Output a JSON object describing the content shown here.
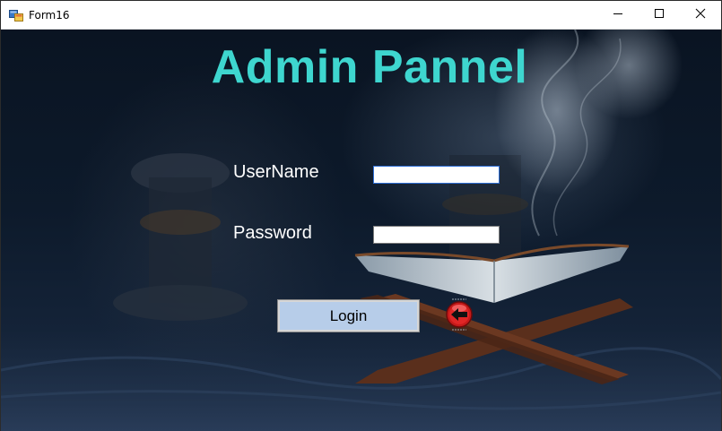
{
  "window": {
    "title": "Form16"
  },
  "page": {
    "heading": "Admin Pannel"
  },
  "form": {
    "username_label": "UserName",
    "username_value": "",
    "password_label": "Password",
    "password_value": "",
    "login_label": "Login"
  },
  "colors": {
    "heading": "#3ed6cf",
    "login_button": "#b7cde9",
    "back_button": "#d21e1e"
  },
  "icons": {
    "app": "form-app-icon",
    "minimize": "minimize-icon",
    "maximize": "maximize-icon",
    "close": "close-icon",
    "back": "back-arrow-icon"
  }
}
